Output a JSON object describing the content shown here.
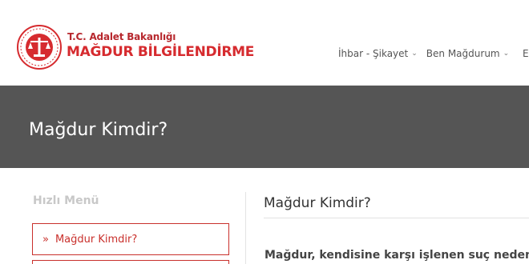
{
  "brand": {
    "ministry": "T.C. Adalet Bakanlığı",
    "name": "MAĞDUR BİLGİLENDİRME"
  },
  "nav": {
    "items": [
      {
        "label": "İhbar - Şikayet"
      },
      {
        "label": "Ben Mağdurum"
      }
    ],
    "edge_label": "E"
  },
  "banner": {
    "title": "Mağdur Kimdir?"
  },
  "sidebar": {
    "heading": "Hızlı Menü",
    "items": [
      {
        "label": "Mağdur Kimdir?"
      }
    ]
  },
  "content": {
    "title": "Mağdur Kimdir?",
    "text": "Mağdur, kendisine karşı işlenen suç nedeniyle"
  },
  "colors": {
    "brand_red": "#d62b2f",
    "banner_bg": "#555555"
  }
}
